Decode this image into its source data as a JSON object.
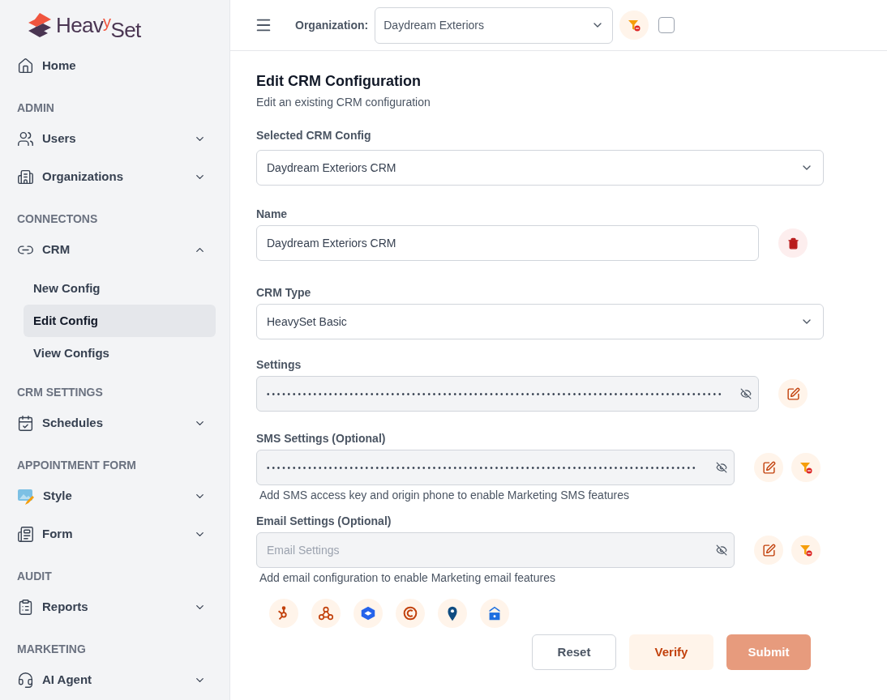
{
  "logo": {
    "part_1": "Heav",
    "part_2": "y",
    "part_3": "Set"
  },
  "sidebar": [
    {
      "kind": "item",
      "label": "Home"
    },
    {
      "kind": "heading",
      "label": "ADMIN"
    },
    {
      "kind": "item",
      "label": "Users",
      "expanded": false
    },
    {
      "kind": "item",
      "label": "Organizations",
      "expanded": false
    },
    {
      "kind": "heading",
      "label": "CONNECTONS"
    },
    {
      "kind": "item",
      "label": "CRM",
      "expanded": true,
      "children": [
        {
          "label": "New Config",
          "selected": false
        },
        {
          "label": "Edit Config",
          "selected": true
        },
        {
          "label": "View Configs",
          "selected": false
        }
      ]
    },
    {
      "kind": "heading",
      "label": "CRM SETTINGS"
    },
    {
      "kind": "item",
      "label": "Schedules",
      "expanded": false
    },
    {
      "kind": "heading",
      "label": "APPOINTMENT FORM"
    },
    {
      "kind": "item",
      "label": "Style",
      "expanded": false
    },
    {
      "kind": "item",
      "label": "Form",
      "expanded": false
    },
    {
      "kind": "heading",
      "label": "AUDIT"
    },
    {
      "kind": "item",
      "label": "Reports",
      "expanded": false
    },
    {
      "kind": "heading",
      "label": "MARKETING"
    },
    {
      "kind": "item",
      "label": "AI Agent",
      "expanded": false
    }
  ],
  "topbar": {
    "org_label": "Organization:",
    "org_value": "Daydream Exteriors",
    "checked": false
  },
  "page": {
    "title": "Edit CRM Configuration",
    "subtitle": "Edit an existing CRM configuration"
  },
  "fields": [
    {
      "kind": "select",
      "label": "Selected CRM Config",
      "value": "Daydream Exteriors CRM"
    },
    {
      "kind": "input",
      "label": "Name",
      "value": "Daydream Exteriors CRM"
    },
    {
      "kind": "select",
      "label": "CRM Type",
      "value": "HeavySet Basic"
    },
    {
      "kind": "secret",
      "label": "Settings",
      "value": "••••••••••••••••••••••••••••••••••••••••••••••••••••••••••••••••••••••••••••••••••••••••"
    },
    {
      "kind": "secret",
      "label": "SMS Settings (Optional)",
      "value": "•••••••••••••••••••••••••••••••••••••••••••••••••••••••••••••••••••••••••••••••••••",
      "help": "Add SMS access key and origin phone to enable Marketing SMS features"
    },
    {
      "kind": "secret",
      "label": "Email Settings (Optional)",
      "placeholder": "Email Settings",
      "help": "Add email configuration to enable Marketing email features"
    }
  ],
  "buttons": [
    {
      "kind": "outline",
      "label": "Reset"
    },
    {
      "kind": "soft",
      "label": "Verify"
    },
    {
      "kind": "primary",
      "label": "Submit",
      "disabled": true
    }
  ]
}
